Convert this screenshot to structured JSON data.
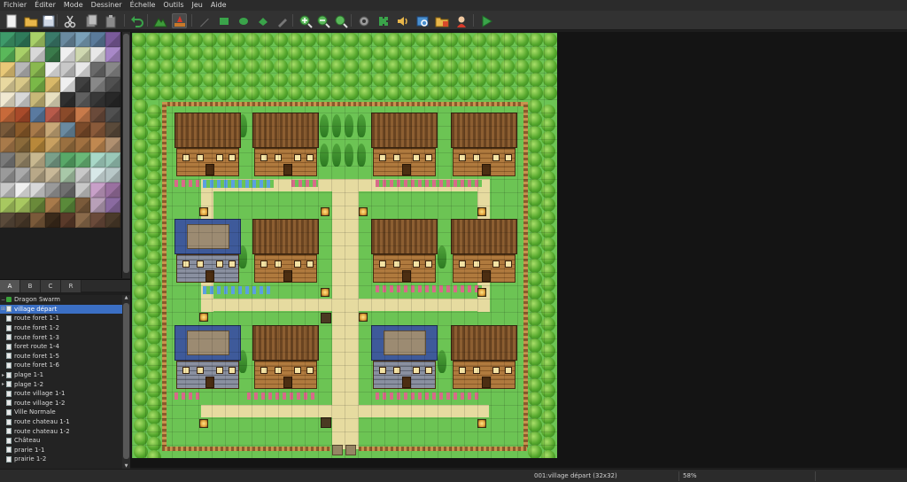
{
  "menu": [
    "Fichier",
    "Éditer",
    "Mode",
    "Dessiner",
    "Échelle",
    "Outils",
    "Jeu",
    "Aide"
  ],
  "toolbar": {
    "icons": [
      "new-project-icon",
      "open-project-icon",
      "save-project-icon",
      "cut-icon",
      "copy-icon",
      "paste-icon",
      "undo-icon",
      "map-mode-icon",
      "event-mode-icon",
      "pencil-icon",
      "rectangle-icon",
      "ellipse-icon",
      "fill-icon",
      "shadow-pen-icon",
      "zoom-in-icon",
      "zoom-out-icon",
      "zoom-actual-icon",
      "database-icon",
      "plugin-manager-icon",
      "sound-test-icon",
      "event-searcher-icon",
      "resource-manager-icon",
      "character-generator-icon",
      "playtest-icon"
    ],
    "active": "event-mode-icon"
  },
  "tileset": {
    "tabs": [
      "A",
      "B",
      "C",
      "R"
    ],
    "active_tab": "A"
  },
  "map_tree": {
    "project": "Dragon Swarm",
    "selected": "village départ",
    "maps": [
      {
        "name": "village départ",
        "expander": "plus"
      },
      {
        "name": "route foret 1-1",
        "expander": ""
      },
      {
        "name": "route foret 1-2",
        "expander": ""
      },
      {
        "name": "route foret 1-3",
        "expander": ""
      },
      {
        "name": "foret route 1-4",
        "expander": ""
      },
      {
        "name": "route foret 1-5",
        "expander": ""
      },
      {
        "name": "route foret 1-6",
        "expander": ""
      },
      {
        "name": "plage 1-1",
        "expander": "arrow"
      },
      {
        "name": "plage 1-2",
        "expander": "arrow"
      },
      {
        "name": "route village 1-1",
        "expander": ""
      },
      {
        "name": "route village 1-2",
        "expander": ""
      },
      {
        "name": "Ville Normale",
        "expander": ""
      },
      {
        "name": "route chateau 1-1",
        "expander": ""
      },
      {
        "name": "route chateau 1-2",
        "expander": ""
      },
      {
        "name": "Château",
        "expander": ""
      },
      {
        "name": "prarie 1-1",
        "expander": ""
      },
      {
        "name": "prairie 1-2",
        "expander": ""
      }
    ]
  },
  "status": {
    "map_info": "001:village départ (32x32)",
    "zoom": "58%"
  },
  "colors": {
    "selection": "#3b6fc4",
    "grass": "#6cc454",
    "path": "#e6dba0"
  }
}
